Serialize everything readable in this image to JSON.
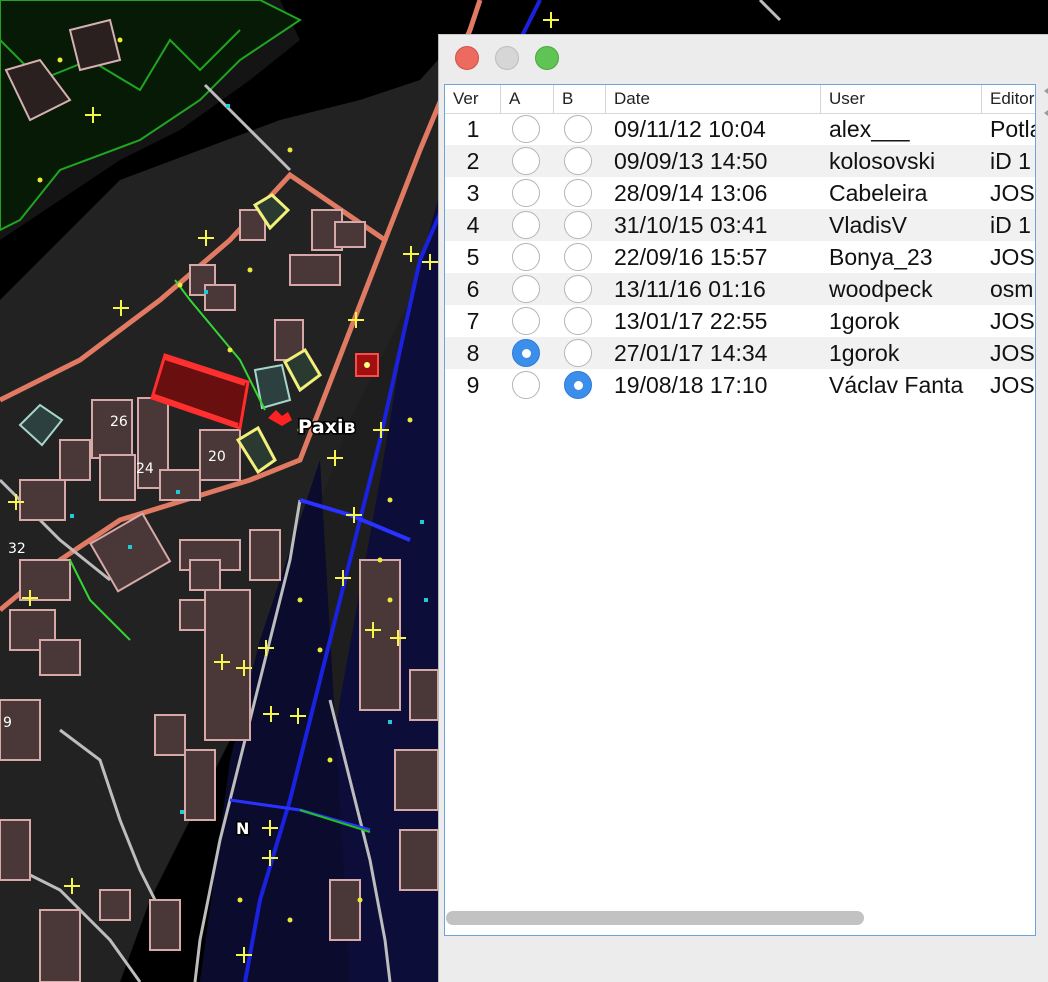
{
  "map": {
    "labels": {
      "place": "Рахів",
      "house_26": "26",
      "house_24": "24",
      "house_20": "20",
      "house_32": "32",
      "house_9": "9",
      "node_n": "N"
    }
  },
  "window": {
    "columns": [
      "Ver",
      "A",
      "B",
      "Date",
      "User",
      "Editor"
    ],
    "rows": [
      {
        "ver": "1",
        "a": false,
        "b": false,
        "date": "09/11/12 10:04",
        "user": "alex___",
        "editor": "Potla"
      },
      {
        "ver": "2",
        "a": false,
        "b": false,
        "date": "09/09/13 14:50",
        "user": "kolosovski",
        "editor": "iD 1"
      },
      {
        "ver": "3",
        "a": false,
        "b": false,
        "date": "28/09/14 13:06",
        "user": "Cabeleira",
        "editor": "JOSM"
      },
      {
        "ver": "4",
        "a": false,
        "b": false,
        "date": "31/10/15 03:41",
        "user": "VladisV",
        "editor": "iD 1"
      },
      {
        "ver": "5",
        "a": false,
        "b": false,
        "date": "22/09/16 15:57",
        "user": "Bonya_23",
        "editor": "JOSM"
      },
      {
        "ver": "6",
        "a": false,
        "b": false,
        "date": "13/11/16 01:16",
        "user": "woodpeck",
        "editor": "osm"
      },
      {
        "ver": "7",
        "a": false,
        "b": false,
        "date": "13/01/17 22:55",
        "user": "1gorok",
        "editor": "JOSM"
      },
      {
        "ver": "8",
        "a": true,
        "b": false,
        "date": "27/01/17 14:34",
        "user": "1gorok",
        "editor": "JOSM"
      },
      {
        "ver": "9",
        "a": false,
        "b": true,
        "date": "19/08/18 17:10",
        "user": "Václav Fanta",
        "editor": "JOSM"
      }
    ]
  }
}
